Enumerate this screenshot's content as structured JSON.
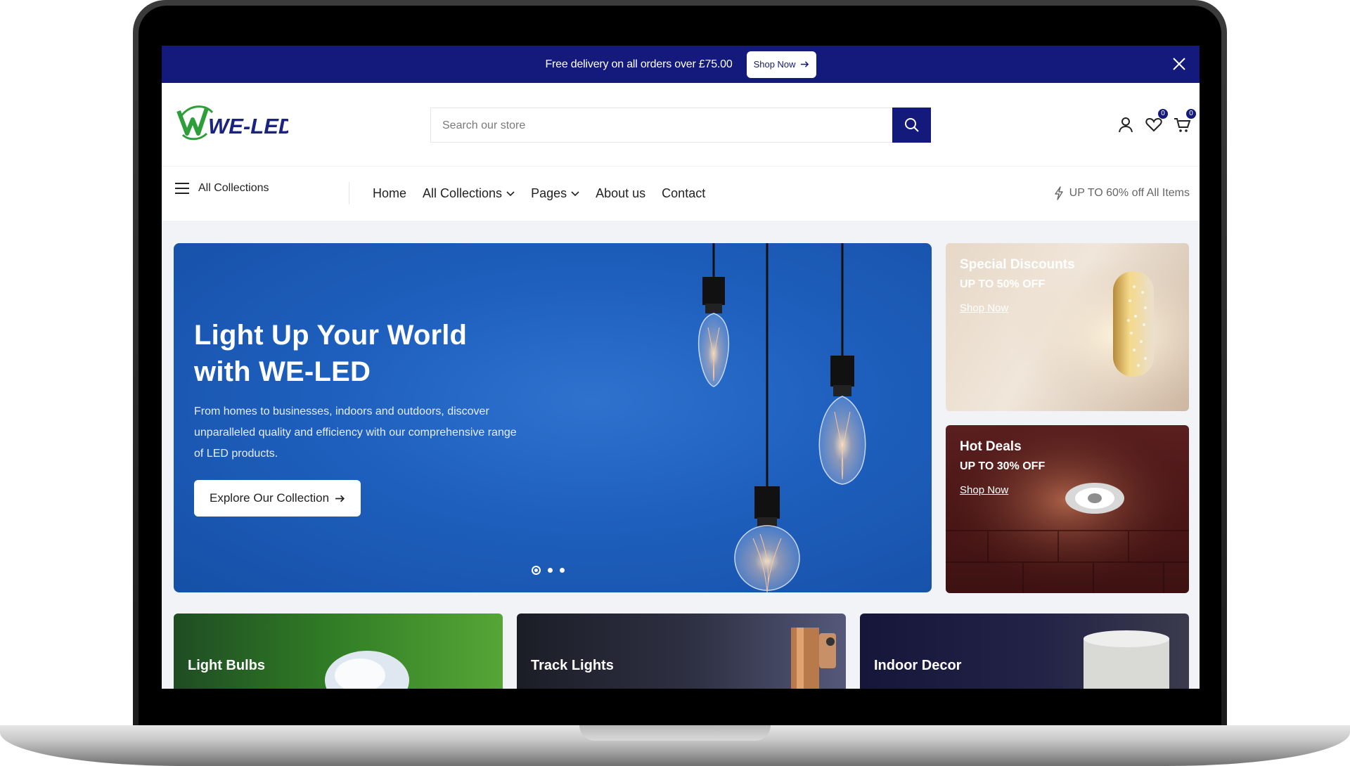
{
  "announcement": {
    "text": "Free delivery on all orders over £75.00",
    "button_label": "Shop Now"
  },
  "header": {
    "logo_text": "WE-LED",
    "search_placeholder": "Search our store",
    "wishlist_count": "0",
    "cart_count": "0"
  },
  "nav": {
    "all_collections": "All Collections",
    "links": [
      "Home",
      "All Collections",
      "Pages",
      "About us",
      "Contact"
    ],
    "promo": "UP TO 60% off All Items"
  },
  "hero": {
    "title_line1": "Light Up Your World",
    "title_line2": "with WE-LED",
    "description": "From homes to businesses, indoors and outdoors, discover unparalleled quality and efficiency with our comprehensive range of LED products.",
    "button_label": "Explore Our Collection"
  },
  "promos": [
    {
      "title": "Special Discounts",
      "subtitle": "UP TO 50% OFF",
      "link": "Shop Now"
    },
    {
      "title": "Hot Deals",
      "subtitle": "UP TO 30% OFF",
      "link": "Shop Now"
    }
  ],
  "categories": [
    "Light Bulbs",
    "Track Lights",
    "Indoor Decor"
  ],
  "colors": {
    "brand_navy": "#131a7c",
    "logo_green": "#2e9e3a",
    "hero_blue": "#1e5fbd"
  }
}
